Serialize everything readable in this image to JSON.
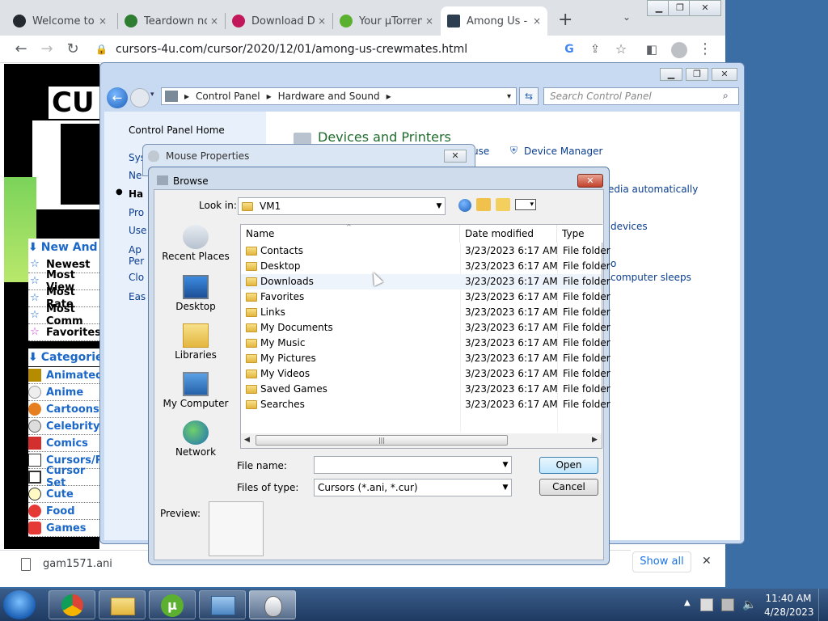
{
  "browser": {
    "tabs": [
      {
        "title": "Welcome to",
        "icon": "github-icon",
        "color": "#24292f"
      },
      {
        "title": "Teardown no",
        "icon": "game-icon",
        "color": "#2e7d32"
      },
      {
        "title": "Download D",
        "icon": "download-icon",
        "color": "#c2185b"
      },
      {
        "title": "Your µTorren",
        "icon": "utorrent-icon",
        "color": "#5bb12f"
      },
      {
        "title": "Among Us -",
        "icon": "cursor-icon",
        "color": "#2c3e50"
      }
    ],
    "url": "cursors-4u.com/cursor/2020/12/01/among-us-crewmates.html",
    "new_tab": "+",
    "close": "×"
  },
  "site": {
    "new_and": "New And",
    "menu": [
      "Newest",
      "Most View",
      "Most Rate",
      "Most Comm",
      "Favorites"
    ],
    "categories_header": "Categorie",
    "categories": [
      "Animated",
      "Anime",
      "Cartoons",
      "Celebrity",
      "Comics",
      "Cursors/P",
      "Cursor Set",
      "Cute",
      "Food",
      "Games"
    ]
  },
  "download_bar": {
    "file": "gam1571.ani",
    "show_all": "Show all",
    "close": "✕"
  },
  "control_panel": {
    "breadcrumb": [
      "Control Panel",
      "Hardware and Sound"
    ],
    "search_placeholder": "Search Control Panel",
    "home": "Control Panel Home",
    "left_fragments": [
      "Sys",
      "Ne",
      "Ha",
      "Pro",
      "Use",
      "Ap",
      "Per",
      "Clo",
      "Eas"
    ],
    "heading": "Devices and Printers",
    "links": [
      "use",
      "Device Manager",
      "edia automatically",
      "devices",
      "o",
      "computer sleeps"
    ]
  },
  "mouse_properties": {
    "title": "Mouse Properties"
  },
  "browse": {
    "title": "Browse",
    "look_in_label": "Look in:",
    "look_in_value": "VM1",
    "places": [
      "Recent Places",
      "Desktop",
      "Libraries",
      "My Computer",
      "Network"
    ],
    "columns": [
      "Name",
      "Date modified",
      "Type"
    ],
    "rows": [
      {
        "name": "Contacts",
        "date": "3/23/2023 6:17 AM",
        "type": "File folder"
      },
      {
        "name": "Desktop",
        "date": "3/23/2023 6:17 AM",
        "type": "File folder"
      },
      {
        "name": "Downloads",
        "date": "3/23/2023 6:17 AM",
        "type": "File folder"
      },
      {
        "name": "Favorites",
        "date": "3/23/2023 6:17 AM",
        "type": "File folder"
      },
      {
        "name": "Links",
        "date": "3/23/2023 6:17 AM",
        "type": "File folder"
      },
      {
        "name": "My Documents",
        "date": "3/23/2023 6:17 AM",
        "type": "File folder"
      },
      {
        "name": "My Music",
        "date": "3/23/2023 6:17 AM",
        "type": "File folder"
      },
      {
        "name": "My Pictures",
        "date": "3/23/2023 6:17 AM",
        "type": "File folder"
      },
      {
        "name": "My Videos",
        "date": "3/23/2023 6:17 AM",
        "type": "File folder"
      },
      {
        "name": "Saved Games",
        "date": "3/23/2023 6:17 AM",
        "type": "File folder"
      },
      {
        "name": "Searches",
        "date": "3/23/2023 6:17 AM",
        "type": "File folder"
      }
    ],
    "file_name_label": "File name:",
    "file_name_value": "",
    "files_of_type_label": "Files of type:",
    "files_of_type_value": "Cursors (*.ani, *.cur)",
    "open": "Open",
    "cancel": "Cancel",
    "preview": "Preview:"
  },
  "taskbar": {
    "time": "11:40 AM",
    "date": "4/28/2023"
  }
}
